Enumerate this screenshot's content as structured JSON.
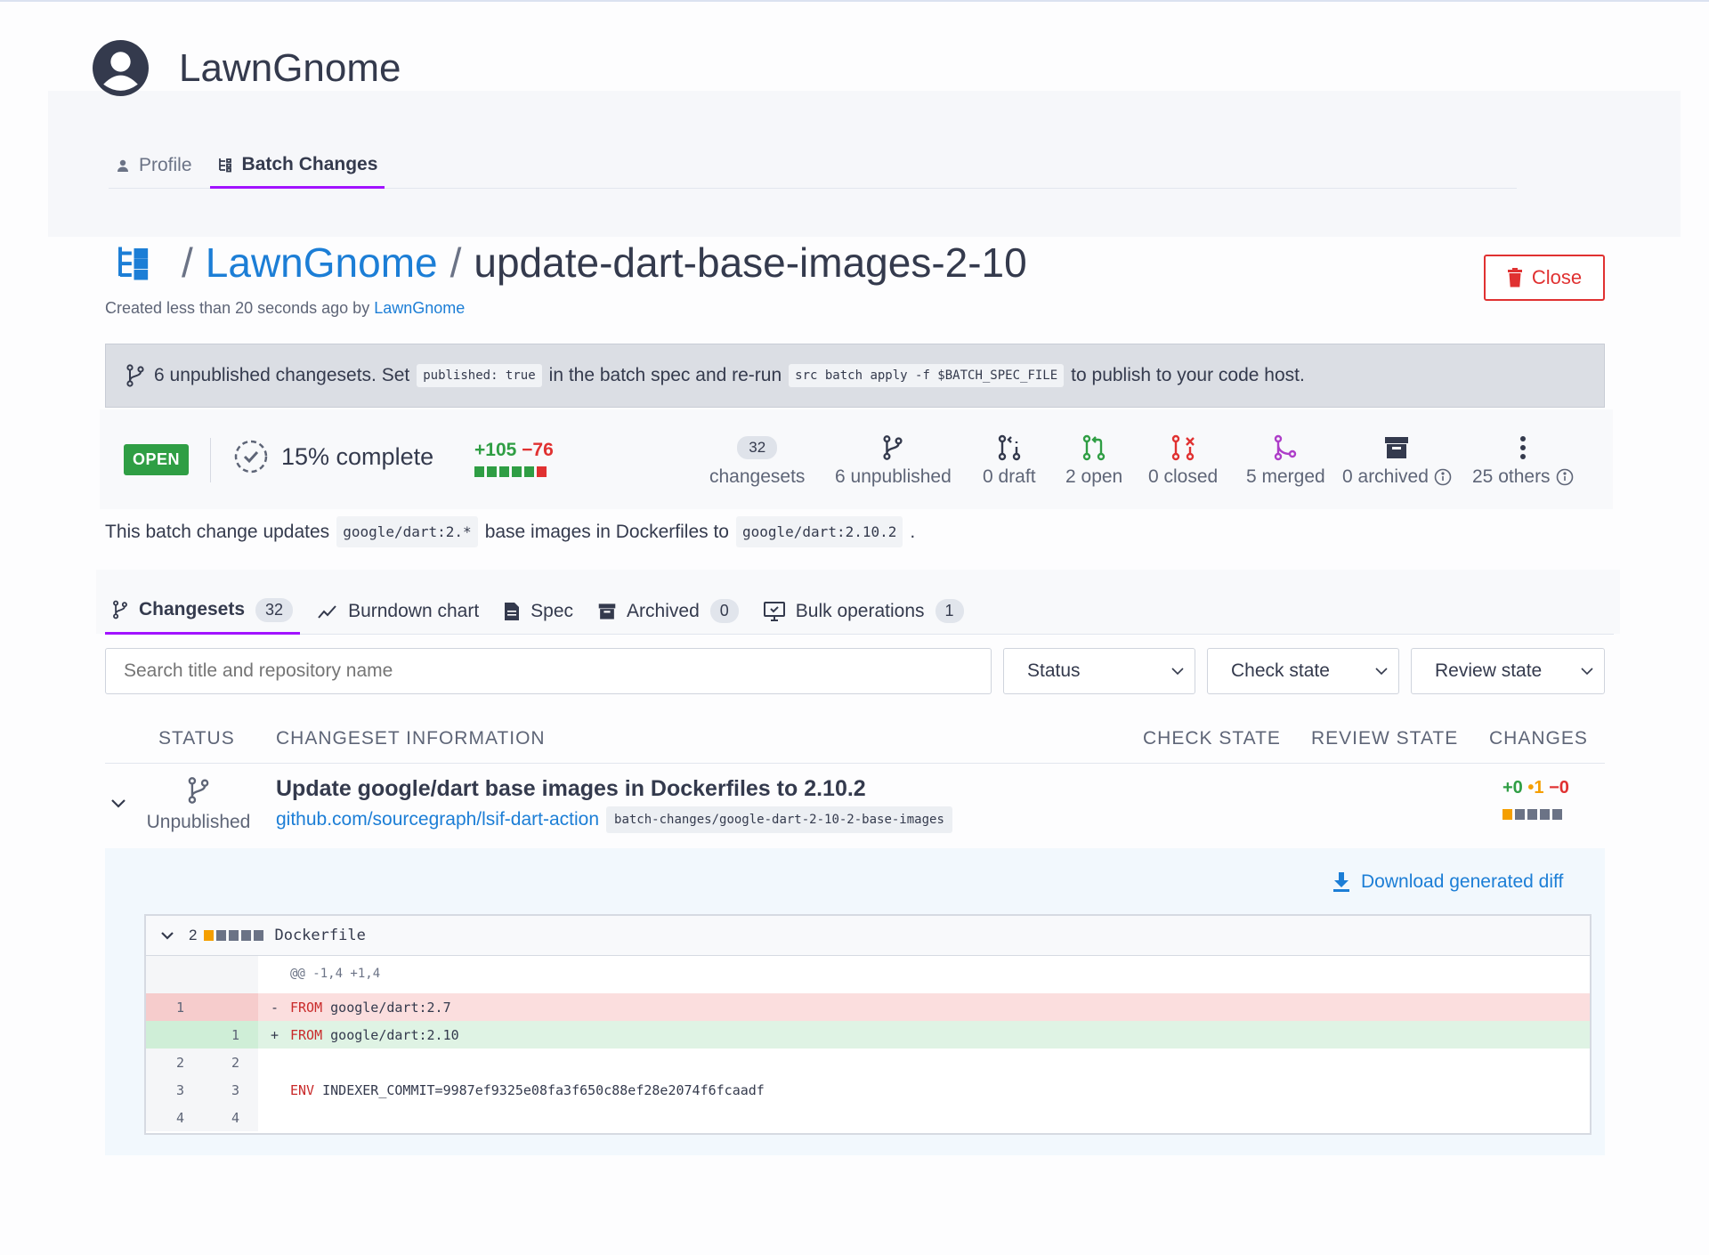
{
  "user": {
    "name": "LawnGnome"
  },
  "user_tabs": [
    {
      "label": "Profile",
      "icon": "person-icon"
    },
    {
      "label": "Batch Changes",
      "icon": "batch-changes-icon",
      "active": true
    }
  ],
  "title": {
    "separator": "/",
    "namespace": "LawnGnome",
    "batch_change_name": "update-dart-base-images-2-10"
  },
  "created": {
    "text": "Created less than 20 seconds ago by",
    "author": "LawnGnome"
  },
  "close_button": {
    "label": "Close"
  },
  "banner": {
    "text1": "6 unpublished changesets. Set",
    "code1": "published: true",
    "text2": "in the batch spec and re-run",
    "code2": "src batch apply -f $BATCH_SPEC_FILE",
    "text3": "to publish to your code host."
  },
  "stats": {
    "state": "OPEN",
    "progress": "15% complete",
    "progress_percent": 15,
    "added": "+105",
    "removed": "−76",
    "total_count": "32",
    "total_label": "changesets",
    "unpublished": "6 unpublished",
    "draft": "0 draft",
    "open": "2 open",
    "closed": "0 closed",
    "merged": "5 merged",
    "archived": "0 archived",
    "others": "25 others"
  },
  "description": {
    "text1": "This batch change updates",
    "code1": "google/dart:2.*",
    "text2": "base images in Dockerfiles to",
    "code2": "google/dart:2.10.2",
    "text3": "."
  },
  "content_tabs": [
    {
      "label": "Changesets",
      "count": "32",
      "active": true
    },
    {
      "label": "Burndown chart"
    },
    {
      "label": "Spec"
    },
    {
      "label": "Archived",
      "count": "0"
    },
    {
      "label": "Bulk operations",
      "count": "1"
    }
  ],
  "filters": {
    "search_placeholder": "Search title and repository name",
    "status": "Status",
    "check_state": "Check state",
    "review_state": "Review state"
  },
  "table_headers": {
    "status": "STATUS",
    "info": "CHANGESET INFORMATION",
    "check_state": "CHECK STATE",
    "review_state": "REVIEW STATE",
    "changes": "CHANGES"
  },
  "changeset": {
    "status": "Unpublished",
    "title": "Update google/dart base images in Dockerfiles to 2.10.2",
    "repo": "github.com/sourcegraph/lsif-dart-action",
    "branch": "batch-changes/google-dart-2-10-2-base-images",
    "added": "+0",
    "modified": "•1",
    "removed": "−0"
  },
  "download_diff": {
    "label": "Download generated diff"
  },
  "file_diff": {
    "count": "2",
    "filename": "Dockerfile",
    "lines": [
      {
        "type": "hunk",
        "old": "",
        "new": "",
        "sign": "",
        "keyword": "",
        "rest": "@@ -1,4 +1,4"
      },
      {
        "type": "del",
        "old": "1",
        "new": "",
        "sign": "-",
        "keyword": "FROM",
        "rest": " google/dart:2.7"
      },
      {
        "type": "add",
        "old": "",
        "new": "1",
        "sign": "+",
        "keyword": "FROM",
        "rest": " google/dart:2.10"
      },
      {
        "type": "ctx",
        "old": "2",
        "new": "2",
        "sign": "",
        "keyword": "",
        "rest": ""
      },
      {
        "type": "ctx",
        "old": "3",
        "new": "3",
        "sign": "",
        "keyword": "ENV",
        "rest": " INDEXER_COMMIT=9987ef9325e08fa3f650c88ef28e2074f6fcaadf"
      },
      {
        "type": "ctx",
        "old": "4",
        "new": "4",
        "sign": "",
        "keyword": "",
        "rest": ""
      }
    ]
  },
  "colors": {
    "accent": "#a112ff",
    "link": "#1c7ed6",
    "success": "#2f9e44",
    "danger": "#e03131",
    "warning": "#f59f00",
    "merged": "#ae3ec9"
  }
}
